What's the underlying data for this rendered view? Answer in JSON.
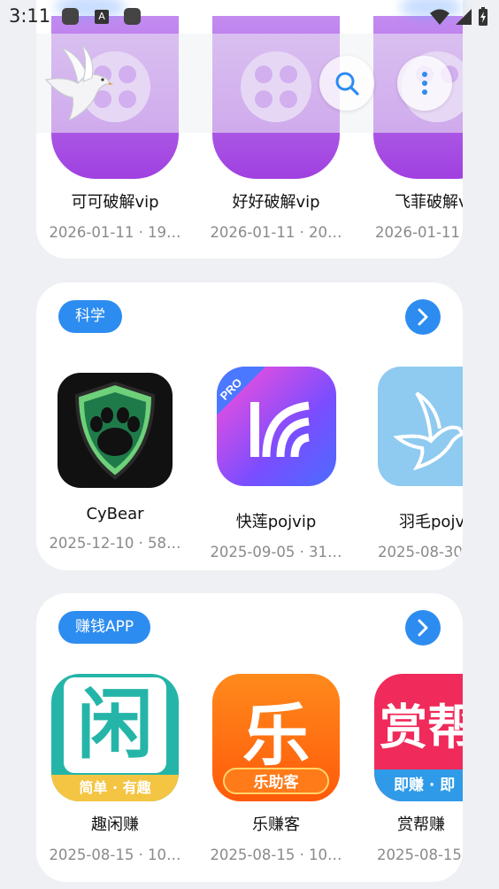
{
  "status_bar": {
    "time": "3:11",
    "notif_label": "A"
  },
  "header": {
    "logo_icon": "dove-logo-icon",
    "search_icon": "search-icon",
    "more_icon": "more-vertical-icon"
  },
  "sections": [
    {
      "apps": [
        {
          "name": "可可破解vip",
          "meta": "2026-01-11 · 19…"
        },
        {
          "name": "好好破解vip",
          "meta": "2026-01-11 · 20…"
        },
        {
          "name": "飞菲破解v",
          "meta": "2026-01-11"
        }
      ]
    },
    {
      "category": "科学",
      "apps": [
        {
          "name": "CyBear",
          "meta": "2025-12-10 · 58…"
        },
        {
          "name": "快莲pojvip",
          "meta": "2025-09-05 · 31…",
          "badge": "PRO"
        },
        {
          "name": "羽毛pojv",
          "meta": "2025-08-30"
        }
      ]
    },
    {
      "category": "赚钱APP",
      "apps": [
        {
          "name": "趣闲赚",
          "meta": "2025-08-15 · 10…",
          "icon_char": "闲",
          "icon_sub": "简单 · 有趣"
        },
        {
          "name": "乐赚客",
          "meta": "2025-08-15 · 10…",
          "icon_char": "乐",
          "icon_sub": "乐助客"
        },
        {
          "name": "赏帮赚",
          "meta": "2025-08-15",
          "icon_char": "赏帮",
          "icon_sub": "即赚 · 即"
        }
      ]
    }
  ],
  "colors": {
    "accent": "#2d8cf0",
    "background": "#eef0f3",
    "card": "#ffffff"
  }
}
